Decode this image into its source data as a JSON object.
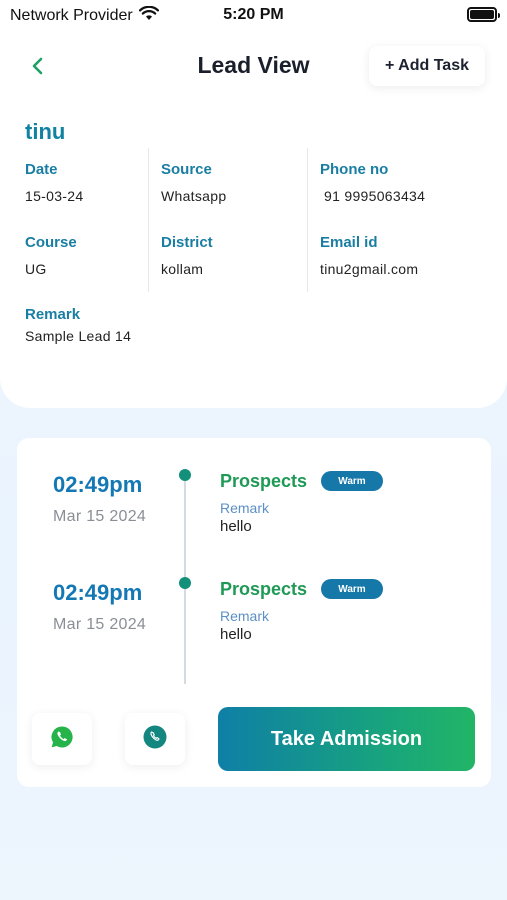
{
  "status_bar": {
    "carrier": "Network Provider",
    "time": "5:20 PM"
  },
  "header": {
    "title": "Lead View",
    "add_task_label": "+ Add Task"
  },
  "lead": {
    "name": "tinu",
    "fields": {
      "date": {
        "label": "Date",
        "value": "15-03-24"
      },
      "source": {
        "label": "Source",
        "value": "Whatsapp"
      },
      "phone": {
        "label": "Phone no",
        "value": "91 9995063434"
      },
      "course": {
        "label": "Course",
        "value": "UG"
      },
      "district": {
        "label": "District",
        "value": "kollam"
      },
      "email": {
        "label": "Email id",
        "value": "tinu2gmail.com"
      },
      "remark": {
        "label": "Remark",
        "value": "Sample Lead 14"
      }
    }
  },
  "timeline": [
    {
      "time": "02:49pm",
      "date": "Mar 15 2024",
      "status": "Prospects",
      "badge": "Warm",
      "remark_label": "Remark",
      "remark": "hello"
    },
    {
      "time": "02:49pm",
      "date": "Mar 15 2024",
      "status": "Prospects",
      "badge": "Warm",
      "remark_label": "Remark",
      "remark": "hello"
    }
  ],
  "actions": {
    "whatsapp_icon": "whatsapp-icon",
    "call_icon": "phone-icon",
    "take_admission_label": "Take Admission"
  },
  "colors": {
    "accent_teal": "#1282a2",
    "status_green": "#1f9a56",
    "badge_blue": "#1678a8",
    "time_blue": "#1478b5"
  }
}
